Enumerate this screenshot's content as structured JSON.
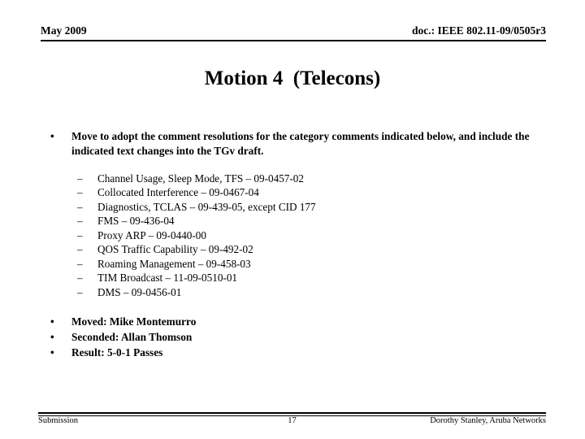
{
  "header": {
    "date": "May 2009",
    "doc_id": "doc.: IEEE 802.11-09/0505r3"
  },
  "title": "Motion 4  (Telecons)",
  "bullet_marker": "•",
  "dash_marker": "–",
  "main_bullet": {
    "text": "Move to adopt the comment resolutions for the category comments indicated below, and include the indicated text changes into the TGv draft."
  },
  "categories": [
    "Channel Usage, Sleep Mode, TFS – 09-0457-02",
    "Collocated Interference – 09-0467-04",
    "Diagnostics, TCLAS – 09-439-05, except CID 177",
    "FMS – 09-436-04",
    "Proxy ARP – 09-0440-00",
    "QOS Traffic Capability – 09-492-02",
    "Roaming Management – 09-458-03",
    "TIM Broadcast – 11-09-0510-01",
    "DMS – 09-0456-01"
  ],
  "motion_outcome": [
    "Moved: Mike Montemurro",
    "Seconded: Allan Thomson",
    "Result: 5-0-1 Passes"
  ],
  "footer": {
    "left": "Submission",
    "page_number": "17",
    "right": "Dorothy Stanley, Aruba Networks"
  }
}
